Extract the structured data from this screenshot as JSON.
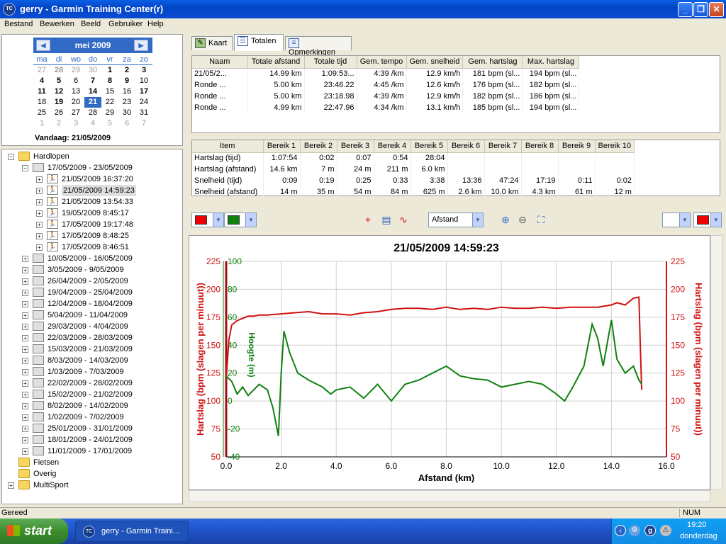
{
  "window": {
    "title": "gerry - Garmin Training Center(r)",
    "icon": "TC"
  },
  "menu": [
    "Bestand",
    "Bewerken",
    "Beeld",
    "Gebruiker",
    "Help"
  ],
  "calendar": {
    "month": "mei 2009",
    "weekdays": [
      "ma",
      "di",
      "wo",
      "do",
      "vr",
      "za",
      "zo"
    ],
    "rows": [
      [
        "27",
        "28",
        "29",
        "30",
        "1",
        "2",
        "3"
      ],
      [
        "4",
        "5",
        "6",
        "7",
        "8",
        "9",
        "10"
      ],
      [
        "11",
        "12",
        "13",
        "14",
        "15",
        "16",
        "17"
      ],
      [
        "18",
        "19",
        "20",
        "21",
        "22",
        "23",
        "24"
      ],
      [
        "25",
        "26",
        "27",
        "28",
        "29",
        "30",
        "31"
      ],
      [
        "1",
        "2",
        "3",
        "4",
        "5",
        "6",
        "7"
      ]
    ],
    "today_label": "Vandaag: 21/05/2009"
  },
  "tree": {
    "root": "Hardlopen",
    "open_week": "17/05/2009 - 23/05/2009",
    "activities": [
      "21/05/2009 16:37:20",
      "21/05/2009 14:59:23",
      "21/05/2009 13:54:33",
      "19/05/2009 8:45:17",
      "17/05/2009 19:17:48",
      "17/05/2009 8:48:25",
      "17/05/2009 8:46:51"
    ],
    "weeks": [
      "10/05/2009 - 16/05/2009",
      "3/05/2009 - 9/05/2009",
      "26/04/2009 - 2/05/2009",
      "19/04/2009 - 25/04/2009",
      "12/04/2009 - 18/04/2009",
      "5/04/2009 - 11/04/2009",
      "29/03/2009 - 4/04/2009",
      "22/03/2009 - 28/03/2009",
      "15/03/2009 - 21/03/2009",
      "8/03/2009 - 14/03/2009",
      "1/03/2009 - 7/03/2009",
      "22/02/2009 - 28/02/2009",
      "15/02/2009 - 21/02/2009",
      "8/02/2009 - 14/02/2009",
      "1/02/2009 - 7/02/2009",
      "25/01/2009 - 31/01/2009",
      "18/01/2009 - 24/01/2009",
      "11/01/2009 - 17/01/2009"
    ],
    "others": [
      "Fietsen",
      "Overig",
      "MultiSport"
    ]
  },
  "tabs": [
    "Kaart",
    "Totalen",
    "Opmerkingen"
  ],
  "totals": {
    "headers": [
      "Naam",
      "Totale afstand",
      "Totale tijd",
      "Gem. tempo",
      "Gem. snelheid",
      "Gem. hartslag",
      "Max. hartslag"
    ],
    "rows": [
      [
        "21/05/2...",
        "14.99 km",
        "1:09:53...",
        "4:39 /km",
        "12.9 km/h",
        "181 bpm (sl...",
        "194 bpm (sl..."
      ],
      [
        "Ronde ...",
        "5.00 km",
        "23:46.22",
        "4:45 /km",
        "12.6 km/h",
        "176 bpm (sl...",
        "182 bpm (sl..."
      ],
      [
        "Ronde ...",
        "5.00 km",
        "23:18.98",
        "4:39 /km",
        "12.9 km/h",
        "182 bpm (sl...",
        "186 bpm (sl..."
      ],
      [
        "Ronde ...",
        "4.99 km",
        "22:47.96",
        "4:34 /km",
        "13.1 km/h",
        "185 bpm (sl...",
        "194 bpm (sl..."
      ]
    ]
  },
  "zones": {
    "headers": [
      "Item",
      "Bereik 1",
      "Bereik 2",
      "Bereik 3",
      "Bereik 4",
      "Bereik 5",
      "Bereik 6",
      "Bereik 7",
      "Bereik 8",
      "Bereik 9",
      "Bereik 10"
    ],
    "rows": [
      [
        "Hartslag (tijd)",
        "1:07:54",
        "0:02",
        "0:07",
        "0:54",
        "28:04",
        "",
        "",
        "",
        "",
        ""
      ],
      [
        "Hartslag (afstand)",
        "14.6 km",
        "7 m",
        "24 m",
        "211 m",
        "6.0 km",
        "",
        "",
        "",
        "",
        ""
      ],
      [
        "Snelheid (tijd)",
        "0:09",
        "0:19",
        "0:25",
        "0:33",
        "3:38",
        "13:36",
        "47:24",
        "17:19",
        "0:11",
        "0:02"
      ],
      [
        "Snelheid (afstand)",
        "14 m",
        "35 m",
        "54 m",
        "84 m",
        "625 m",
        "2.6 km",
        "10.0 km",
        "4.3 km",
        "61 m",
        "12 m"
      ]
    ]
  },
  "toolbar": {
    "xaxis_select": "Afstand"
  },
  "colors": {
    "hr": "#d01010",
    "alt": "#108010",
    "chart_title": "#000000"
  },
  "chart_data": {
    "type": "line",
    "title": "21/05/2009 14:59:23",
    "xlabel": "Afstand (km)",
    "ylabel_left": "Hartslag (bpm (slagen per minuut))",
    "ylabel_right": "Hartslag (bpm (slagen per minuut))",
    "ylabel_alt": "Hoogte (m)",
    "xlim": [
      0,
      16
    ],
    "ylim_hr": [
      50,
      225
    ],
    "ylim_alt": [
      -40,
      100
    ],
    "xticks": [
      "0.0",
      "2.0",
      "4.0",
      "6.0",
      "8.0",
      "10.0",
      "12.0",
      "14.0",
      "16.0"
    ],
    "yticks_hr": [
      "50",
      "75",
      "100",
      "125",
      "150",
      "175",
      "200",
      "225"
    ],
    "yticks_alt": [
      "-40",
      "-20",
      "0",
      "20",
      "40",
      "60",
      "80",
      "100"
    ],
    "grid": true,
    "series": [
      {
        "name": "Hartslag",
        "axis": "hr",
        "x": [
          0,
          0.1,
          0.2,
          0.4,
          0.6,
          0.8,
          1.0,
          1.2,
          1.5,
          2.0,
          2.5,
          3.0,
          3.5,
          4.0,
          4.5,
          5.0,
          5.5,
          6.0,
          6.5,
          7.0,
          7.5,
          8.0,
          8.5,
          9.0,
          9.5,
          10.0,
          10.5,
          11.0,
          11.5,
          12.0,
          12.5,
          13.0,
          13.5,
          14.0,
          14.2,
          14.5,
          14.8,
          15.0,
          15.05,
          15.1
        ],
        "y": [
          120,
          155,
          168,
          172,
          174,
          176,
          176,
          177,
          177,
          178,
          179,
          180,
          178,
          178,
          177,
          179,
          180,
          182,
          183,
          183,
          182,
          184,
          182,
          183,
          182,
          184,
          183,
          183,
          184,
          183,
          184,
          184,
          184,
          186,
          188,
          186,
          192,
          193,
          150,
          110
        ]
      },
      {
        "name": "Hoogte",
        "axis": "alt",
        "x": [
          0,
          0.2,
          0.4,
          0.6,
          0.8,
          1.0,
          1.2,
          1.5,
          1.7,
          1.9,
          2.0,
          2.1,
          2.3,
          2.6,
          3.0,
          3.5,
          3.8,
          4.0,
          4.5,
          5.0,
          5.5,
          6.0,
          6.5,
          7.0,
          7.5,
          8.0,
          8.5,
          9.0,
          9.5,
          10.0,
          10.5,
          11.0,
          11.5,
          12.0,
          12.3,
          12.6,
          13.0,
          13.3,
          13.5,
          13.7,
          14.0,
          14.2,
          14.5,
          14.8,
          15.0,
          15.1
        ],
        "y": [
          18,
          14,
          5,
          10,
          4,
          8,
          12,
          8,
          -5,
          -25,
          20,
          50,
          35,
          20,
          15,
          10,
          5,
          8,
          10,
          2,
          12,
          0,
          12,
          15,
          20,
          25,
          18,
          16,
          15,
          10,
          12,
          14,
          12,
          5,
          0,
          10,
          25,
          55,
          45,
          25,
          58,
          30,
          20,
          25,
          15,
          12
        ]
      }
    ]
  }
}
